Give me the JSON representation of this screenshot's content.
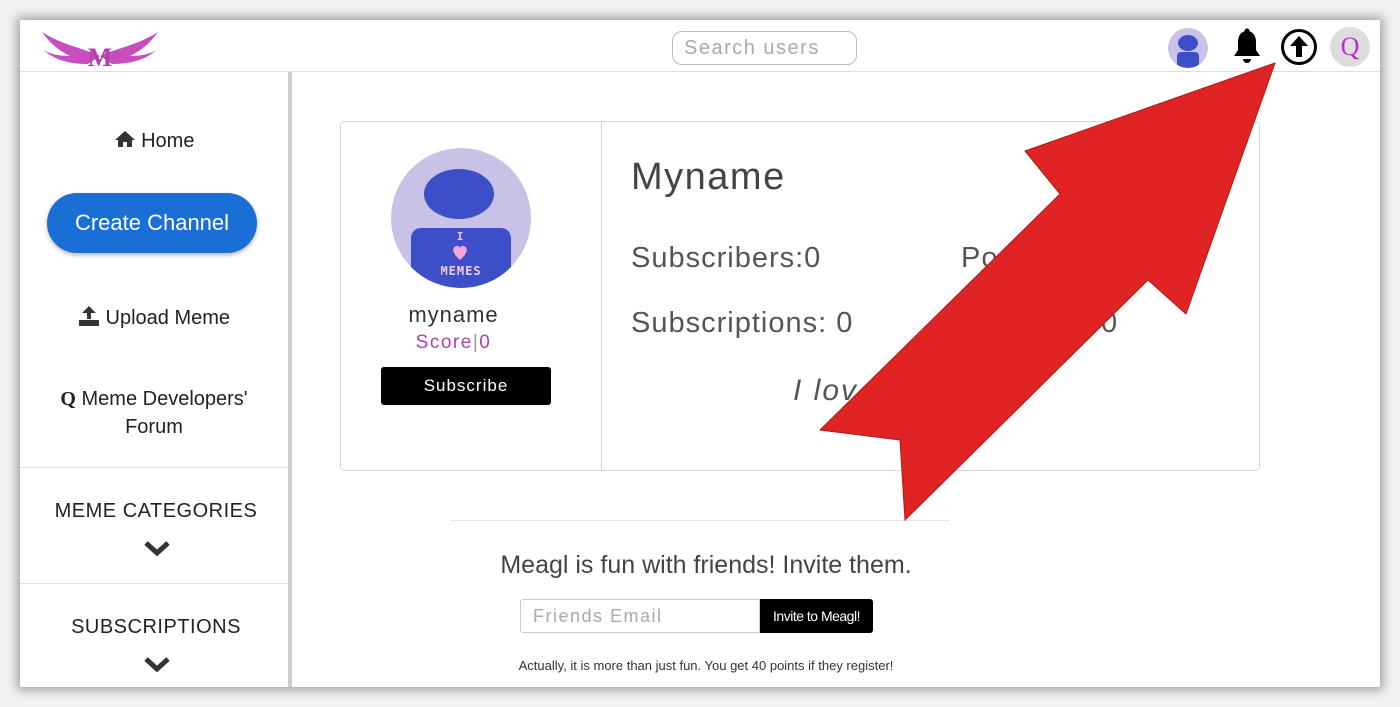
{
  "header": {
    "search_placeholder": "Search users",
    "logo_letter": "M",
    "forum_letter": "Q"
  },
  "sidebar": {
    "home_label": "Home",
    "create_channel_label": "Create Channel",
    "upload_meme_label": "Upload Meme",
    "forum_label": "Meme Developers' Forum",
    "forum_icon_letter": "Q",
    "categories_label": "MEME CATEGORIES",
    "subscriptions_label": "SUBSCRIPTIONS"
  },
  "profile": {
    "username": "myname",
    "score_label": "Score",
    "score_value": "0",
    "subscribe_label": "Subscribe",
    "display_name": "Myname",
    "subscribers_label": "Subscribers:",
    "subscribers_value": "0",
    "subscriptions_label": "Subscriptions:",
    "subscriptions_value": "0",
    "posts_partial": "Po",
    "second_value_partial": "0",
    "bio_partial": "I lov",
    "avatar_text_top": "I",
    "avatar_text_bottom": "MEMES"
  },
  "invite": {
    "title": "Meagl is fun with friends! Invite them.",
    "email_placeholder": "Friends Email",
    "button_label": "Invite to Meagl!",
    "fine_print": "Actually, it is more than just fun. You get 40 points if they register!"
  },
  "colors": {
    "accent_blue": "#1a6fd6",
    "score_purple": "#b33db3",
    "annotation_arrow": "#e02424",
    "logo_magenta": "#c84dbf"
  },
  "icons": {
    "home": "home-icon",
    "upload": "upload-icon",
    "bell": "bell-icon",
    "upload_circle": "upload-circle-icon",
    "chevron": "chevron-down-icon"
  }
}
